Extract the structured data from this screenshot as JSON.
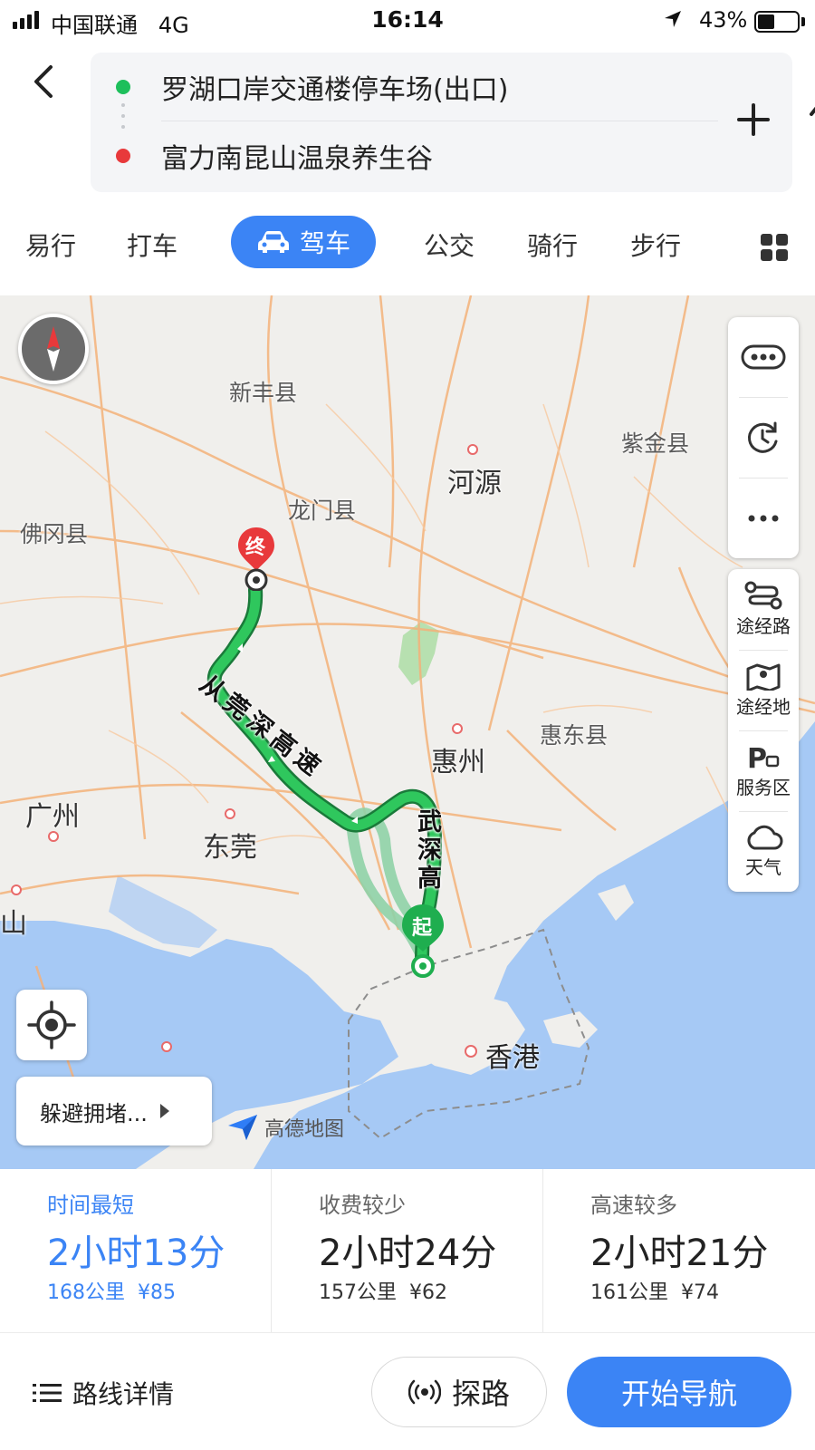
{
  "status_bar": {
    "carrier": "中国联通",
    "network": "4G",
    "time": "16:14",
    "battery": "43%",
    "battery_level": 0.43
  },
  "route": {
    "start": "罗湖口岸交通楼停车场(出口)",
    "end": "富力南昆山温泉养生谷",
    "start_color": "#1dbf5b",
    "end_color": "#e8393b"
  },
  "modes": {
    "items": [
      "易行",
      "打车",
      "驾车",
      "公交",
      "骑行",
      "步行"
    ],
    "active": "驾车",
    "accent": "#3b84f5"
  },
  "map": {
    "places": {
      "xinfeng": "新丰县",
      "zijin": "紫金县",
      "heyuan": "河源",
      "longmen": "龙门县",
      "fogang": "佛冈县",
      "huidong": "惠东县",
      "huizhou": "惠州",
      "guangzhou": "广州",
      "dongguan": "东莞",
      "foshan": "佛山",
      "hongkong": "香港"
    },
    "road_labels": {
      "conghuan": "从莞深高速",
      "wushen": "武深高"
    },
    "pin_end": "终",
    "pin_start": "起",
    "avoid_label": "躲避拥堵...",
    "logo": "高德地图",
    "side_tools": [
      "途经路",
      "途经地",
      "服务区",
      "天气"
    ],
    "route_color": "#1fae4f"
  },
  "options": [
    {
      "tag": "时间最短",
      "duration": "2小时13分",
      "distance": "168公里",
      "toll": "¥85",
      "active": true
    },
    {
      "tag": "收费较少",
      "duration": "2小时24分",
      "distance": "157公里",
      "toll": "¥62",
      "active": false
    },
    {
      "tag": "高速较多",
      "duration": "2小时21分",
      "distance": "161公里",
      "toll": "¥74",
      "active": false
    }
  ],
  "bottom": {
    "details": "路线详情",
    "explore": "探路",
    "start_nav": "开始导航"
  }
}
